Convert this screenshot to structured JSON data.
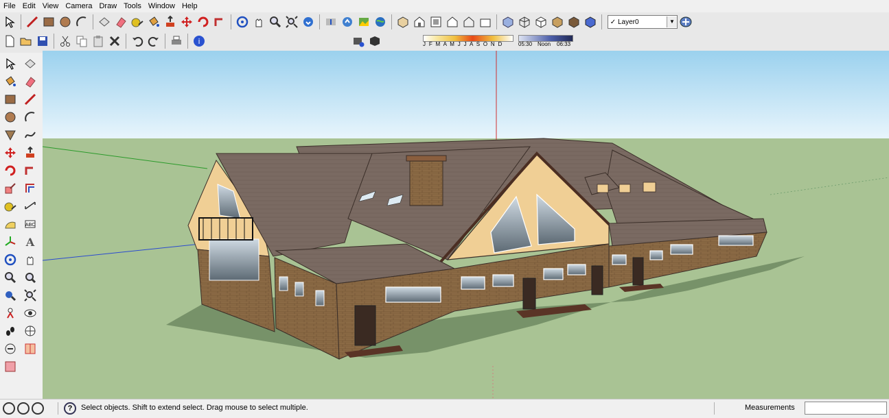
{
  "menu": [
    "File",
    "Edit",
    "View",
    "Camera",
    "Draw",
    "Tools",
    "Window",
    "Help"
  ],
  "toolbar": {
    "row1": [
      "select-icon",
      "line-icon",
      "rectangle-icon",
      "circle-icon",
      "arc-icon",
      "make-component-icon",
      "eraser-icon",
      "tape-measure-icon",
      "paint-bucket-icon",
      "push-pull-icon",
      "move-icon",
      "rotate-icon",
      "follow-me-icon",
      "orbit-icon",
      "pan-icon",
      "zoom-icon",
      "zoom-extents-icon",
      "get-models-icon",
      "share-model-icon",
      "share-component-icon",
      "photo-textures-icon",
      "google-earth-icon",
      "iso-view-icon",
      "front-view-icon",
      "top-view-icon",
      "right-view-icon",
      "back-view-icon",
      "left-view-icon",
      "xray-icon",
      "wireframe-icon",
      "hidden-line-icon",
      "shaded-icon",
      "shaded-textures-icon",
      "monochrome-icon"
    ],
    "row2": [
      "new-icon",
      "open-icon",
      "save-icon",
      "cut-icon",
      "copy-icon",
      "paste-icon",
      "erase-icon",
      "undo-icon",
      "redo-icon",
      "print-icon",
      "model-info-icon"
    ],
    "shadow_buttons": [
      "shadow-settings-icon",
      "display-shadows-icon"
    ]
  },
  "layer": {
    "name": "Layer0",
    "checked": true
  },
  "shadows": {
    "months": "J F M A M J J A S O N D",
    "time_start": "05:30",
    "time_noon": "Noon",
    "time_end": "06:33"
  },
  "left_tools": [
    "select-icon",
    "make-component-icon",
    "paint-bucket-icon",
    "eraser-icon",
    "rectangle-icon",
    "line-icon",
    "circle-icon",
    "arc-icon",
    "polygon-icon",
    "freehand-icon",
    "move-icon",
    "push-pull-icon",
    "rotate-icon",
    "follow-me-icon",
    "scale-icon",
    "offset-icon",
    "tape-measure-icon",
    "dimension-icon",
    "protractor-icon",
    "text-icon",
    "axes-icon",
    "3d-text-icon",
    "orbit-icon",
    "pan-icon",
    "zoom-icon",
    "zoom-window-icon",
    "previous-view-icon",
    "zoom-extents-icon",
    "position-camera-icon",
    "look-around-icon",
    "walk-icon",
    "section-plane-icon",
    "section-display-icon",
    "section-cuts-icon",
    "xray-section-icon"
  ],
  "status": {
    "icons": [
      "geo-location-icon",
      "credits-icon",
      "user-icon"
    ],
    "message": "Select objects. Shift to extend select. Drag mouse to select multiple.",
    "measurements_label": "Measurements",
    "measurements_value": ""
  },
  "colors": {
    "sky_top": "#9bd1ee",
    "sky_bottom": "#e8f5fc",
    "ground": "#a9c394",
    "roof": "#7a6a62",
    "brick": "#8b6a45",
    "stucco": "#f0cf95"
  }
}
